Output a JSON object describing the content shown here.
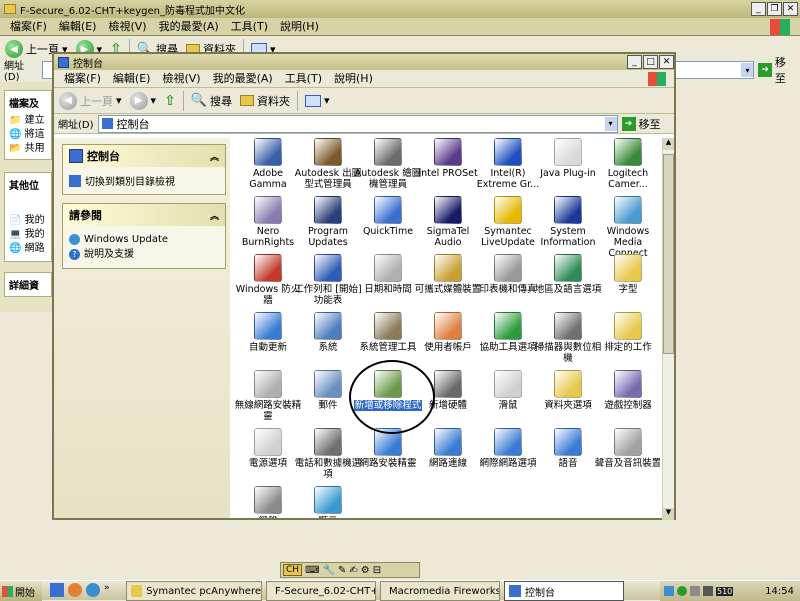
{
  "bg_window": {
    "title": "F-Secure_6.02-CHT+keygen_防毒程式加中文化",
    "menu": [
      "檔案(F)",
      "編輯(E)",
      "檢視(V)",
      "我的最愛(A)",
      "工具(T)",
      "說明(H)"
    ],
    "back_label": "上一頁",
    "search_label": "搜尋",
    "folders_label": "資料夾",
    "address_label": "網址(D)",
    "go_label": "移至"
  },
  "bg_left": {
    "section1": "檔案及",
    "items1": [
      "建立",
      "將這",
      "共用"
    ],
    "section2": "其他位",
    "items2": [
      "我的",
      "我的",
      "網路"
    ],
    "section3": "詳細資"
  },
  "cp_window": {
    "title": "控制台",
    "menu": [
      "檔案(F)",
      "編輯(E)",
      "檢視(V)",
      "我的最愛(A)",
      "工具(T)",
      "說明(H)"
    ],
    "back_label": "上一頁",
    "search_label": "搜尋",
    "folders_label": "資料夾",
    "address_label": "網址(D)",
    "address_value": "控制台",
    "go_label": "移至"
  },
  "task_pane": {
    "panel1_title": "控制台",
    "panel1_link": "切換到類別目錄檢視",
    "panel2_title": "請參閱",
    "panel2_links": [
      "Windows Update",
      "說明及支援"
    ]
  },
  "icons": [
    {
      "label": "Adobe Gamma",
      "color": "#3a5fa8"
    },
    {
      "label": "Autodesk 出圖型式管理員",
      "color": "#7d5a2b"
    },
    {
      "label": "Autodesk 繪圖機管理員",
      "color": "#6b6b6b"
    },
    {
      "label": "Intel PROSet",
      "color": "#5b3a8a"
    },
    {
      "label": "Intel(R) Extreme Gr...",
      "color": "#1f4fc2"
    },
    {
      "label": "Java Plug-in",
      "color": "#d9d9d9"
    },
    {
      "label": "Logitech Camer...",
      "color": "#3a8a3a"
    },
    {
      "label": "Nero BurnRights",
      "color": "#8a7ab0"
    },
    {
      "label": "Program Updates",
      "color": "#2a3f7a"
    },
    {
      "label": "QuickTime",
      "color": "#3a6fd0"
    },
    {
      "label": "SigmaTel Audio",
      "color": "#1a1a6a"
    },
    {
      "label": "Symantec LiveUpdate",
      "color": "#e6b800"
    },
    {
      "label": "System Information",
      "color": "#1a3a9a"
    },
    {
      "label": "Windows Media Connect",
      "color": "#4a9ad0"
    },
    {
      "label": "Windows 防火牆",
      "color": "#c0392b"
    },
    {
      "label": "工作列和 [開始] 功能表",
      "color": "#2e5cb8"
    },
    {
      "label": "日期和時間",
      "color": "#b0b0b0"
    },
    {
      "label": "可攜式媒體裝置",
      "color": "#c9a032"
    },
    {
      "label": "印表機和傳真",
      "color": "#9a9a9a"
    },
    {
      "label": "地區及語言選項",
      "color": "#2e8b57"
    },
    {
      "label": "字型",
      "color": "#e8c84a"
    },
    {
      "label": "自動更新",
      "color": "#3a7bd5"
    },
    {
      "label": "系統",
      "color": "#4f7ec0"
    },
    {
      "label": "系統管理工具",
      "color": "#8a7a5a"
    },
    {
      "label": "使用者帳戶",
      "color": "#e08040"
    },
    {
      "label": "協助工具選項",
      "color": "#2e9b3e"
    },
    {
      "label": "掃描器與數位相機",
      "color": "#707070"
    },
    {
      "label": "排定的工作",
      "color": "#e8c84a"
    },
    {
      "label": "無線網路安裝精靈",
      "color": "#b0b0b0"
    },
    {
      "label": "郵件",
      "color": "#6a8fc0"
    },
    {
      "label": "新增或移除程式",
      "color": "#6a9a4a"
    },
    {
      "label": "新增硬體",
      "color": "#6a6a6a"
    },
    {
      "label": "滑鼠",
      "color": "#d0d0d0"
    },
    {
      "label": "資料夾選項",
      "color": "#e8c84a"
    },
    {
      "label": "遊戲控制器",
      "color": "#7a6ab0"
    },
    {
      "label": "電源選項",
      "color": "#d0d0d0"
    },
    {
      "label": "電話和數據機選項",
      "color": "#707070"
    },
    {
      "label": "網路安裝精靈",
      "color": "#3a7bd5"
    },
    {
      "label": "網路連線",
      "color": "#3a7bd5"
    },
    {
      "label": "網際網路選項",
      "color": "#3a7bd5"
    },
    {
      "label": "語音",
      "color": "#3a7bd5"
    },
    {
      "label": "聲音及音訊裝置",
      "color": "#a0a0a0"
    },
    {
      "label": "鍵盤",
      "color": "#8a8a8a"
    },
    {
      "label": "顯示",
      "color": "#3a9ad0"
    }
  ],
  "taskbar": {
    "start": "開始",
    "items": [
      "Symantec pcAnywhere",
      "F-Secure_6.02-CHT+key...",
      "Macromedia Fireworks M...",
      "控制台"
    ],
    "clock": "14:54",
    "lang": "CH",
    "tray_box": "510"
  }
}
